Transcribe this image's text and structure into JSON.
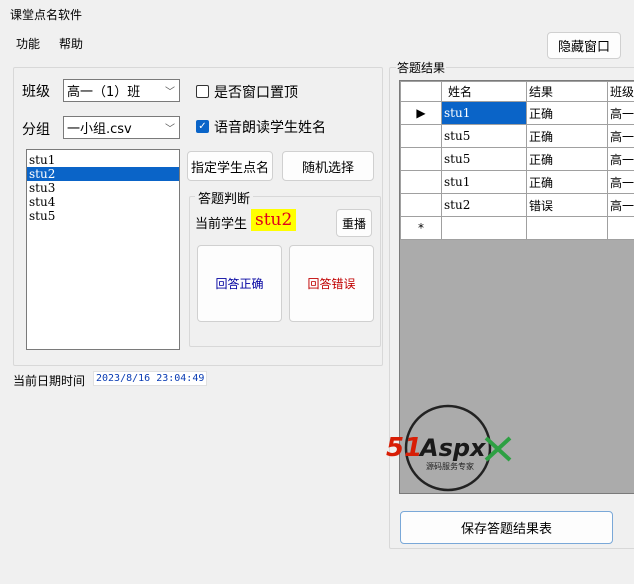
{
  "window": {
    "title": "课堂点名软件"
  },
  "menu": [
    {
      "label": "功能"
    },
    {
      "label": "帮助"
    }
  ],
  "hide_button": "隐藏窗口",
  "class_label": "班级",
  "class_value": "高一（1）班",
  "group_label": "分组",
  "group_value": "一小组.csv",
  "topmost_checkbox": {
    "label": "是否窗口置顶",
    "checked": false
  },
  "voice_checkbox": {
    "label": "语音朗读学生姓名",
    "checked": true
  },
  "students": [
    "stu1",
    "stu2",
    "stu3",
    "stu4",
    "stu5"
  ],
  "selected_student_index": 1,
  "assign_button": "指定学生点名",
  "random_button": "随机选择",
  "judge_group_title": "答题判断",
  "current_student_label": "当前学生",
  "current_student_name": "stu2",
  "replay_button": "重播",
  "correct_button": "回答正确",
  "wrong_button": "回答错误",
  "date_label": "当前日期时间",
  "date_value": "2023/8/16 23:04:49",
  "results_title": "答题结果",
  "results_columns": [
    "姓名",
    "结果",
    "班级"
  ],
  "results_rows": [
    [
      "stu1",
      "正确",
      "高一"
    ],
    [
      "stu5",
      "正确",
      "高一"
    ],
    [
      "stu5",
      "正确",
      "高一"
    ],
    [
      "stu1",
      "正确",
      "高一"
    ],
    [
      "stu2",
      "错误",
      "高一"
    ]
  ],
  "new_row_marker": "*",
  "save_button": "保存答题结果表",
  "watermark": {
    "brand": "51Aspx",
    "tagline": "源码服务专家"
  },
  "colors": {
    "accent": "#0a64c8",
    "highlight": "#ffff00",
    "student_name": "#e0001b",
    "correct": "#0000a0",
    "wrong": "#c00000"
  }
}
